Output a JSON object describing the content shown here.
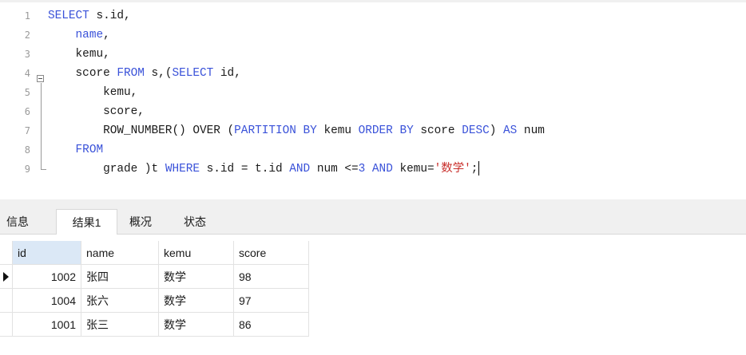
{
  "editor": {
    "lines": [
      {
        "n": "1",
        "segs": [
          {
            "t": "SELECT",
            "c": "kw"
          },
          {
            "t": " s.id,",
            "c": ""
          }
        ]
      },
      {
        "n": "2",
        "segs": [
          {
            "t": "    ",
            "c": ""
          },
          {
            "t": "name",
            "c": "kw"
          },
          {
            "t": ",",
            "c": ""
          }
        ]
      },
      {
        "n": "3",
        "segs": [
          {
            "t": "    kemu,",
            "c": ""
          }
        ]
      },
      {
        "n": "4",
        "segs": [
          {
            "t": "    score ",
            "c": ""
          },
          {
            "t": "FROM",
            "c": "kw"
          },
          {
            "t": " s,(",
            "c": ""
          },
          {
            "t": "SELECT",
            "c": "kw"
          },
          {
            "t": " id,",
            "c": ""
          }
        ]
      },
      {
        "n": "5",
        "segs": [
          {
            "t": "        kemu,",
            "c": ""
          }
        ]
      },
      {
        "n": "6",
        "segs": [
          {
            "t": "        score,",
            "c": ""
          }
        ]
      },
      {
        "n": "7",
        "segs": [
          {
            "t": "        ROW_NUMBER() OVER (",
            "c": ""
          },
          {
            "t": "PARTITION BY",
            "c": "kw"
          },
          {
            "t": " kemu ",
            "c": ""
          },
          {
            "t": "ORDER BY",
            "c": "kw"
          },
          {
            "t": " score ",
            "c": ""
          },
          {
            "t": "DESC",
            "c": "kw"
          },
          {
            "t": ") ",
            "c": ""
          },
          {
            "t": "AS",
            "c": "kw"
          },
          {
            "t": " num",
            "c": ""
          }
        ]
      },
      {
        "n": "8",
        "segs": [
          {
            "t": "    ",
            "c": ""
          },
          {
            "t": "FROM",
            "c": "kw"
          }
        ]
      },
      {
        "n": "9",
        "segs": [
          {
            "t": "        grade )t ",
            "c": ""
          },
          {
            "t": "WHERE",
            "c": "kw"
          },
          {
            "t": " s.id = t.id ",
            "c": ""
          },
          {
            "t": "AND",
            "c": "kw"
          },
          {
            "t": " num <=",
            "c": ""
          },
          {
            "t": "3",
            "c": "kw"
          },
          {
            "t": " ",
            "c": ""
          },
          {
            "t": "AND",
            "c": "kw"
          },
          {
            "t": " kemu=",
            "c": ""
          },
          {
            "t": "'数学'",
            "c": "str"
          },
          {
            "t": ";",
            "c": ""
          }
        ]
      }
    ]
  },
  "tabs": [
    {
      "label": "信息",
      "active": false
    },
    {
      "label": "结果1",
      "active": true
    },
    {
      "label": "概况",
      "active": false
    },
    {
      "label": "状态",
      "active": false
    }
  ],
  "result": {
    "columns": [
      "id",
      "name",
      "kemu",
      "score"
    ],
    "rows": [
      [
        "1002",
        "张四",
        "数学",
        "98"
      ],
      [
        "1004",
        "张六",
        "数学",
        "97"
      ],
      [
        "1001",
        "张三",
        "数学",
        "86"
      ]
    ],
    "selected_row": 0
  },
  "colors": {
    "keyword": "#3a52d9",
    "string": "#c9302c",
    "header_selected": "#dbe8f6"
  }
}
